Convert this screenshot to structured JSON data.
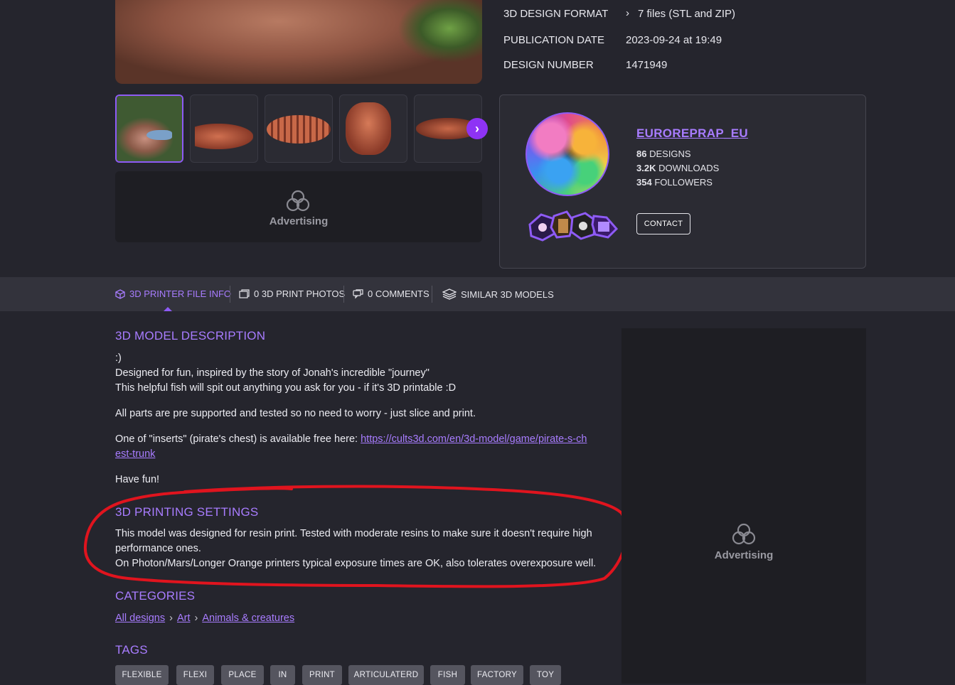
{
  "specs": [
    {
      "label": "3D DESIGN FORMAT",
      "value": "7 files (STL and ZIP)",
      "chevron": "chevron-right-icon"
    },
    {
      "label": "PUBLICATION DATE",
      "value": "2023-09-24 at 19:49"
    },
    {
      "label": "DESIGN NUMBER",
      "value": "1471949"
    }
  ],
  "gallery": {
    "next_icon": "chevron-right-icon"
  },
  "ads": {
    "top_label": "Advertising",
    "right_label": "Advertising"
  },
  "creator": {
    "name": "EUROREPRAP_EU",
    "designs_count": "86",
    "designs_label": "DESIGNS",
    "downloads_count": "3.2K",
    "downloads_label": "DOWNLOADS",
    "followers_count": "354",
    "followers_label": "FOLLOWERS",
    "contact_label": "CONTACT"
  },
  "tabs": [
    {
      "label": "3D PRINTER FILE INFO",
      "icon": "cube-icon",
      "active": true
    },
    {
      "label": "0 3D PRINT PHOTOS",
      "icon": "photos-icon"
    },
    {
      "label": "0 COMMENTS",
      "icon": "comments-icon"
    },
    {
      "label": "SIMILAR 3D MODELS",
      "icon": "layers-icon"
    }
  ],
  "description": {
    "title": "3D MODEL DESCRIPTION",
    "line1": ":)",
    "line2": "Designed for fun, inspired by the story of Jonah's incredible \"journey\"",
    "line3": "This helpful fish will spit out anything you ask for you - if it's 3D printable :D",
    "line4": "All parts are pre supported and tested so no need to worry - just slice and print.",
    "line5_prefix": "One of \"inserts\" (pirate's chest) is available free here: ",
    "line5_link": "https://cults3d.com/en/3d-model/game/pirate-s-chest-trunk",
    "line6": "Have fun!"
  },
  "printing": {
    "title": "3D PRINTING SETTINGS",
    "line1": "This model was designed for resin print. Tested with moderate resins to make sure it doesn't require high performance ones.",
    "line2": "On Photon/Mars/Longer Orange printers typical exposure times are OK, also tolerates overexposure well."
  },
  "categories": {
    "title": "CATEGORIES",
    "items": [
      "All designs",
      "Art",
      "Animals & creatures"
    ],
    "separator": "›"
  },
  "tags": {
    "title": "TAGS",
    "items": [
      "FLEXIBLE",
      "FLEXI",
      "PLACE",
      "IN",
      "PRINT",
      "ARTICULATERD",
      "FISH",
      "FACTORY",
      "TOY"
    ]
  },
  "colors": {
    "accent": "#a87cff",
    "annotation": "#e0141e",
    "background": "#25252d"
  }
}
